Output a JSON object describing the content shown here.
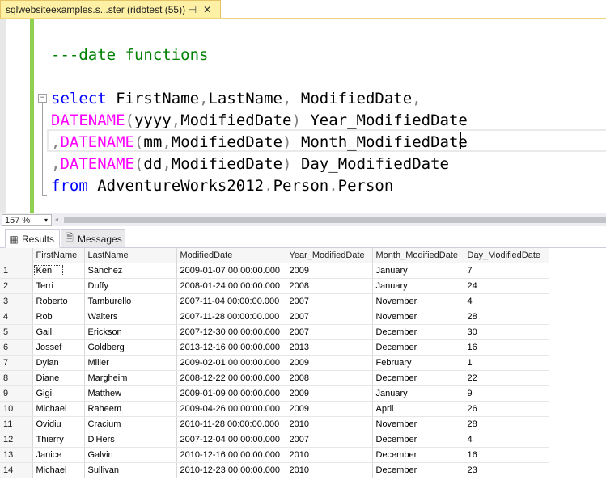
{
  "document_tab": {
    "title": "sqlwebsiteexamples.s...ster (ridbtest (55))*",
    "pin_icon": "⊣",
    "close_icon": "✕"
  },
  "editor": {
    "comment": "---date functions",
    "lines": [
      [
        {
          "t": "select",
          "c": "kw"
        },
        {
          "t": " FirstName",
          "c": ""
        },
        {
          "t": ",",
          "c": "op"
        },
        {
          "t": "LastName",
          "c": ""
        },
        {
          "t": ",",
          "c": "op"
        },
        {
          "t": " ModifiedDate",
          "c": ""
        },
        {
          "t": ",",
          "c": "op"
        }
      ],
      [
        {
          "t": "DATENAME",
          "c": "fn"
        },
        {
          "t": "(",
          "c": "op"
        },
        {
          "t": "yyyy",
          "c": ""
        },
        {
          "t": ",",
          "c": "op"
        },
        {
          "t": "ModifiedDate",
          "c": ""
        },
        {
          "t": ")",
          "c": "op"
        },
        {
          "t": " Year_ModifiedDate",
          "c": ""
        }
      ],
      [
        {
          "t": ",",
          "c": "op"
        },
        {
          "t": "DATENAME",
          "c": "fn"
        },
        {
          "t": "(",
          "c": "op"
        },
        {
          "t": "mm",
          "c": ""
        },
        {
          "t": ",",
          "c": "op"
        },
        {
          "t": "ModifiedDate",
          "c": ""
        },
        {
          "t": ")",
          "c": "op"
        },
        {
          "t": " Month_ModifiedDate",
          "c": ""
        }
      ],
      [
        {
          "t": ",",
          "c": "op"
        },
        {
          "t": "DATENAME",
          "c": "fn"
        },
        {
          "t": "(",
          "c": "op"
        },
        {
          "t": "dd",
          "c": ""
        },
        {
          "t": ",",
          "c": "op"
        },
        {
          "t": "ModifiedDate",
          "c": ""
        },
        {
          "t": ")",
          "c": "op"
        },
        {
          "t": " Day_ModifiedDate",
          "c": ""
        }
      ],
      [
        {
          "t": "from",
          "c": "kw"
        },
        {
          "t": " AdventureWorks2012",
          "c": ""
        },
        {
          "t": ".",
          "c": "op"
        },
        {
          "t": "Person",
          "c": ""
        },
        {
          "t": ".",
          "c": "op"
        },
        {
          "t": "Person",
          "c": ""
        }
      ]
    ],
    "fold_icon": "−"
  },
  "zoom": {
    "value": "157 %",
    "arrow_icon": "▾",
    "scroll_left_icon": "◂"
  },
  "result_tabs": {
    "results_label": "Results",
    "results_icon": "▦",
    "messages_label": "Messages",
    "messages_icon": "🗎"
  },
  "grid": {
    "columns": [
      "FirstName",
      "LastName",
      "ModifiedDate",
      "Year_ModifiedDate",
      "Month_ModifiedDate",
      "Day_ModifiedDate"
    ],
    "rows": [
      [
        "1",
        "Ken",
        "Sánchez",
        "2009-01-07 00:00:00.000",
        "2009",
        "January",
        "7"
      ],
      [
        "2",
        "Terri",
        "Duffy",
        "2008-01-24 00:00:00.000",
        "2008",
        "January",
        "24"
      ],
      [
        "3",
        "Roberto",
        "Tamburello",
        "2007-11-04 00:00:00.000",
        "2007",
        "November",
        "4"
      ],
      [
        "4",
        "Rob",
        "Walters",
        "2007-11-28 00:00:00.000",
        "2007",
        "November",
        "28"
      ],
      [
        "5",
        "Gail",
        "Erickson",
        "2007-12-30 00:00:00.000",
        "2007",
        "December",
        "30"
      ],
      [
        "6",
        "Jossef",
        "Goldberg",
        "2013-12-16 00:00:00.000",
        "2013",
        "December",
        "16"
      ],
      [
        "7",
        "Dylan",
        "Miller",
        "2009-02-01 00:00:00.000",
        "2009",
        "February",
        "1"
      ],
      [
        "8",
        "Diane",
        "Margheim",
        "2008-12-22 00:00:00.000",
        "2008",
        "December",
        "22"
      ],
      [
        "9",
        "Gigi",
        "Matthew",
        "2009-01-09 00:00:00.000",
        "2009",
        "January",
        "9"
      ],
      [
        "10",
        "Michael",
        "Raheem",
        "2009-04-26 00:00:00.000",
        "2009",
        "April",
        "26"
      ],
      [
        "11",
        "Ovidiu",
        "Cracium",
        "2010-11-28 00:00:00.000",
        "2010",
        "November",
        "28"
      ],
      [
        "12",
        "Thierry",
        "D'Hers",
        "2007-12-04 00:00:00.000",
        "2007",
        "December",
        "4"
      ],
      [
        "13",
        "Janice",
        "Galvin",
        "2010-12-16 00:00:00.000",
        "2010",
        "December",
        "16"
      ],
      [
        "14",
        "Michael",
        "Sullivan",
        "2010-12-23 00:00:00.000",
        "2010",
        "December",
        "23"
      ]
    ]
  }
}
